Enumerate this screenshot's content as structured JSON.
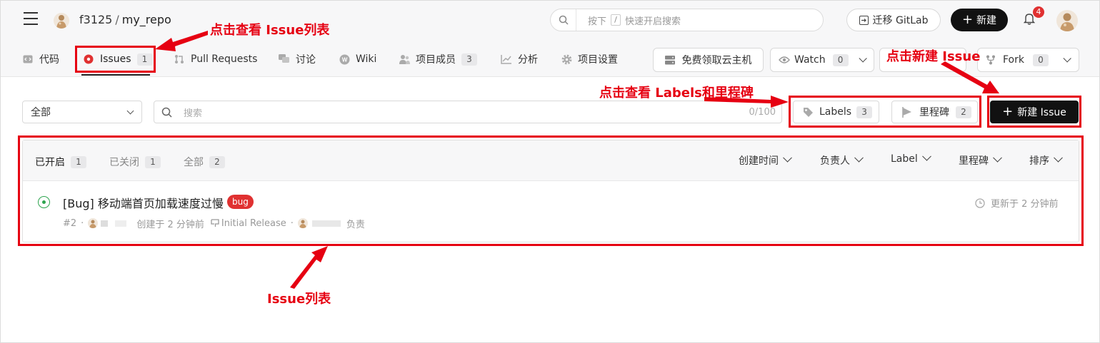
{
  "header": {
    "user": "f3125",
    "separator": "/",
    "repo": "my_repo",
    "search_placeholder_prefix": "按下",
    "search_key": "/",
    "search_placeholder_suffix": "快速开启搜索",
    "migrate_label": "迁移 GitLab",
    "new_label": "新建",
    "notification_count": "4"
  },
  "nav": {
    "tabs": [
      {
        "label": "代码",
        "icon": "code-icon"
      },
      {
        "label": "Issues",
        "icon": "issue-icon",
        "count": "1"
      },
      {
        "label": "Pull Requests",
        "icon": "pull-request-icon"
      },
      {
        "label": "讨论",
        "icon": "discussion-icon"
      },
      {
        "label": "Wiki",
        "icon": "wiki-icon"
      },
      {
        "label": "项目成员",
        "icon": "members-icon",
        "count": "3"
      },
      {
        "label": "分析",
        "icon": "chart-icon"
      },
      {
        "label": "项目设置",
        "icon": "gear-icon"
      }
    ],
    "cloud_label": "免费领取云主机",
    "watch_label": "Watch",
    "watch_count": "0",
    "fork_label": "Fork",
    "fork_count": "0"
  },
  "toolbar": {
    "filter_value": "全部",
    "search_placeholder": "搜索",
    "search_counter": "0/100",
    "labels_label": "Labels",
    "labels_count": "3",
    "milestones_label": "里程碑",
    "milestones_count": "2",
    "new_issue_label": "新建 Issue"
  },
  "list": {
    "state_tabs": [
      {
        "label": "已开启",
        "count": "1"
      },
      {
        "label": "已关闭",
        "count": "1"
      },
      {
        "label": "全部",
        "count": "2"
      }
    ],
    "filters": [
      "创建时间",
      "负责人",
      "Label",
      "里程碑",
      "排序"
    ],
    "issues": [
      {
        "title": "[Bug] 移动端首页加载速度过慢",
        "label": "bug",
        "number": "#2",
        "dot": "·",
        "created": "创建于 2 分钟前",
        "milestone": "Initial Release",
        "assignee_suffix": "负责",
        "updated": "更新于 2 分钟前"
      }
    ]
  },
  "annotations": {
    "issues_tab": "点击查看 Issue列表",
    "new_issue": "点击新建 Issue",
    "labels_milestones": "点击查看 Labels和里程碑",
    "issue_list": "Issue列表"
  },
  "colors": {
    "annotation_red": "#e60012",
    "primary_black": "#111111",
    "bug_label": "#e03131",
    "open_issue": "#2da44e"
  }
}
